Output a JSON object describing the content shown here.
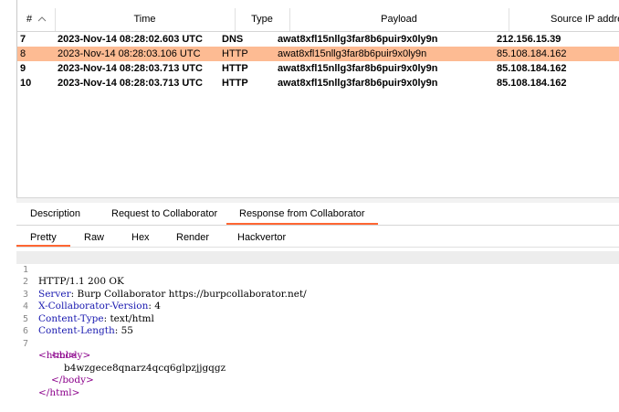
{
  "table": {
    "headers": {
      "num": "#",
      "time": "Time",
      "type": "Type",
      "payload": "Payload",
      "source_ip": "Source IP address"
    },
    "rows": [
      {
        "num": "7",
        "time": "2023-Nov-14 08:28:02.603 UTC",
        "type": "DNS",
        "payload": "awat8xfl15nllg3far8b6puir9x0ly9n",
        "source_ip": "212.156.15.39",
        "selected": false
      },
      {
        "num": "8",
        "time": "2023-Nov-14 08:28:03.106 UTC",
        "type": "HTTP",
        "payload": "awat8xfl15nllg3far8b6puir9x0ly9n",
        "source_ip": "85.108.184.162",
        "selected": true
      },
      {
        "num": "9",
        "time": "2023-Nov-14 08:28:03.713 UTC",
        "type": "HTTP",
        "payload": "awat8xfl15nllg3far8b6puir9x0ly9n",
        "source_ip": "85.108.184.162",
        "selected": false
      },
      {
        "num": "10",
        "time": "2023-Nov-14 08:28:03.713 UTC",
        "type": "HTTP",
        "payload": "awat8xfl15nllg3far8b6puir9x0ly9n",
        "source_ip": "85.108.184.162",
        "selected": false
      }
    ],
    "selection_color": "#fdbb93",
    "sort_icon": "chevron-up-icon"
  },
  "detail_tabs": [
    "Description",
    "Request to Collaborator",
    "Response from Collaborator"
  ],
  "view_tabs": [
    "Pretty",
    "Raw",
    "Hex",
    "Render",
    "Hackvertor"
  ],
  "accent_color": "#ff6633",
  "response": {
    "status_line": "HTTP/1.1 200 OK",
    "headers": [
      {
        "name": "Server",
        "value": " Burp Collaborator https://burpcollaborator.net/"
      },
      {
        "name": "X-Collaborator-Version",
        "value": " 4"
      },
      {
        "name": "Content-Type",
        "value": " text/html"
      },
      {
        "name": "Content-Length",
        "value": " 55"
      }
    ],
    "html_open": "<html>",
    "body_open": "<body>",
    "body_text": "b4wzgece8qnarz4qcq6glpzjjgqgz",
    "body_close": "</body>",
    "html_close": "</html>",
    "line_numbers": [
      "1",
      "2",
      "3",
      "4",
      "5",
      "6",
      "7"
    ]
  }
}
